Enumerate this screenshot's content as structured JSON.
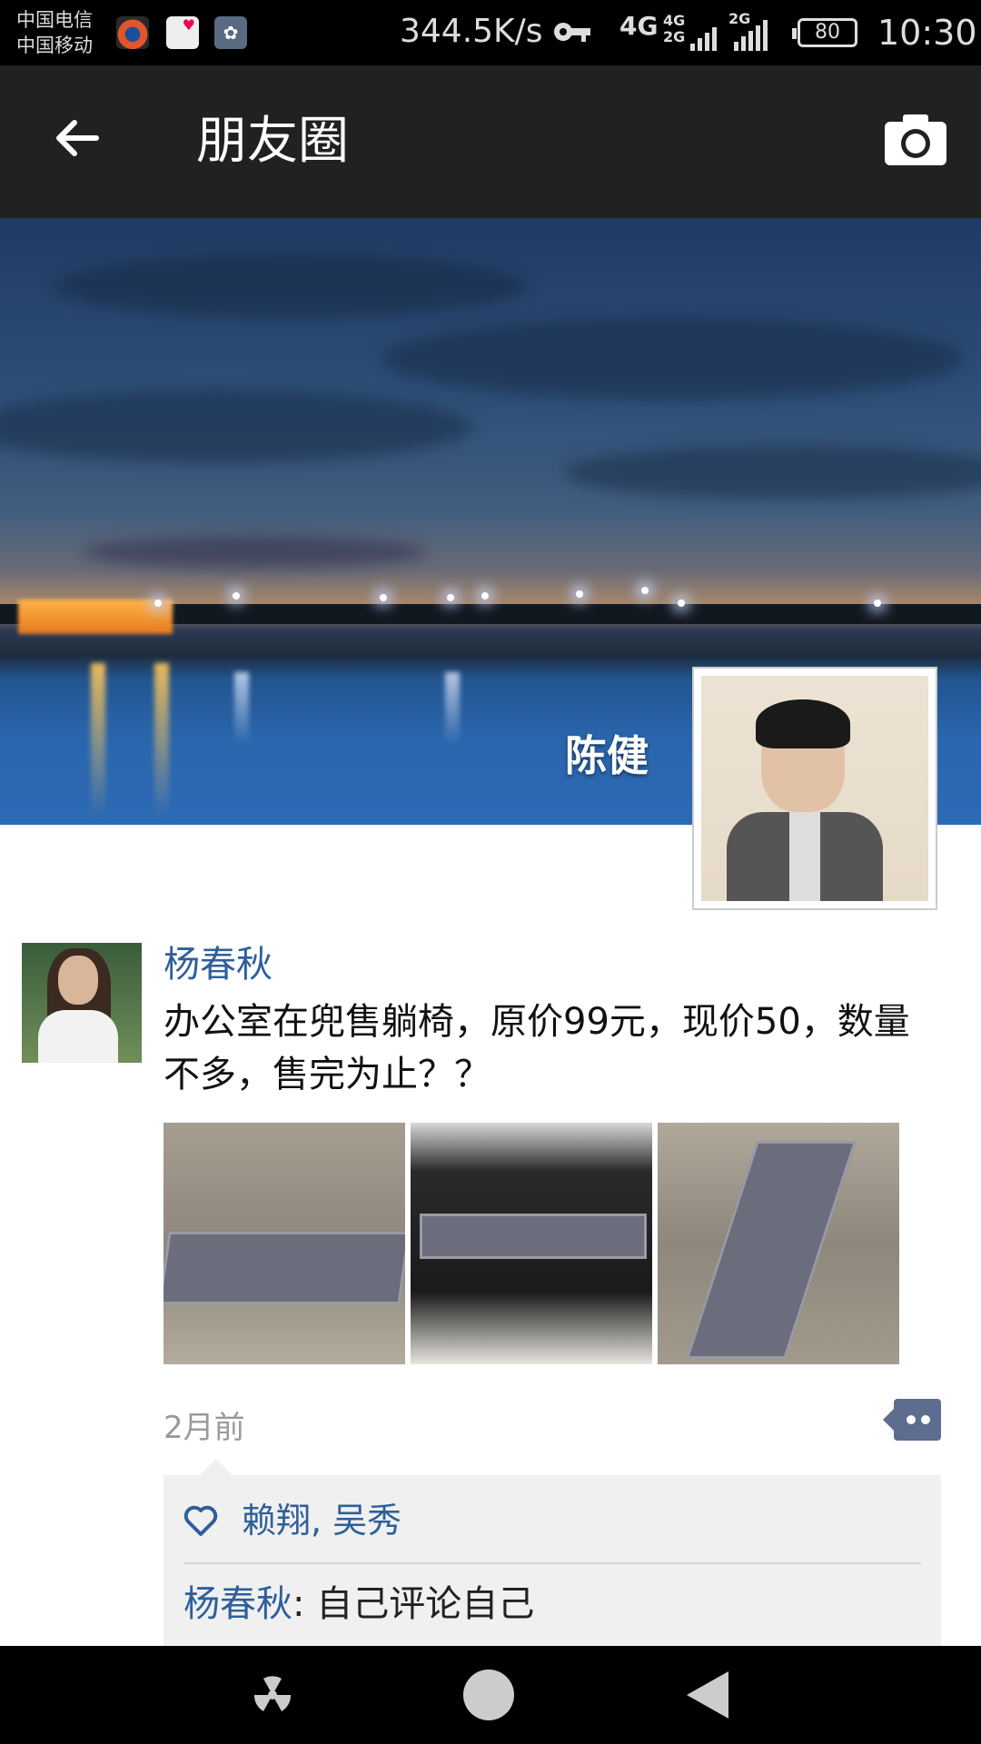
{
  "status_bar": {
    "carrier_1": "中国电信",
    "carrier_2": "中国移动",
    "speed": "344.5K/s",
    "network_1": "4G",
    "network_2_top": "4G",
    "network_2_bottom": "2G",
    "network_3": "2G",
    "battery": "80",
    "time": "10:30"
  },
  "app_bar": {
    "title": "朋友圈",
    "back_icon": "arrow-left",
    "camera_icon": "camera"
  },
  "cover": {
    "owner_name": "陈健"
  },
  "post": {
    "author": "杨春秋",
    "text": "办公室在兜售躺椅，原价99元，现价50，数量不多，售完为止？？",
    "photo_count": 3,
    "time": "2月前",
    "likes": "赖翔, 吴秀",
    "comments": [
      {
        "author": "杨春秋",
        "separator": ": ",
        "text": "自己评论自己"
      }
    ]
  },
  "nav_bar": {
    "buttons": [
      "menu",
      "home",
      "back"
    ]
  },
  "colors": {
    "link_blue": "#2f5f9a",
    "app_bar": "#212121",
    "comment_bg": "#f0f0f0"
  }
}
